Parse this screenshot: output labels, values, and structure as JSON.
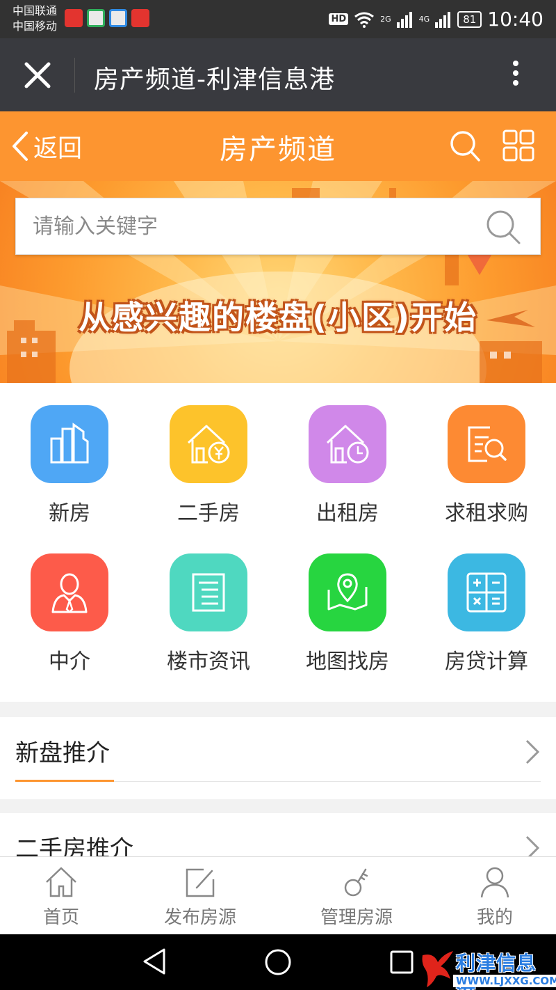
{
  "status_bar": {
    "carrier_1": "中国联通",
    "carrier_2": "中国移动",
    "hd": "HD",
    "net_2g": "2G",
    "net_4g": "4G",
    "battery": "81",
    "time": "10:40"
  },
  "titlebar": {
    "title": "房产频道-利津信息港"
  },
  "header": {
    "back_label": "返回",
    "title": "房产频道",
    "accent_color": "#fd9530"
  },
  "banner": {
    "search_placeholder": "请输入关键字",
    "slogan": "从感兴趣的楼盘(小区)开始"
  },
  "categories": [
    {
      "label": "新房",
      "icon": "buildings-icon",
      "color": "#4fa7f5"
    },
    {
      "label": "二手房",
      "icon": "house-yuan-icon",
      "color": "#fdc32b"
    },
    {
      "label": "出租房",
      "icon": "house-clock-icon",
      "color": "#d088e9"
    },
    {
      "label": "求租求购",
      "icon": "document-search-icon",
      "color": "#fd8a33"
    },
    {
      "label": "中介",
      "icon": "agent-person-icon",
      "color": "#fd5b4a"
    },
    {
      "label": "楼市资讯",
      "icon": "news-document-icon",
      "color": "#4fd8c0"
    },
    {
      "label": "地图找房",
      "icon": "map-pin-icon",
      "color": "#27d540"
    },
    {
      "label": "房贷计算",
      "icon": "calculator-icon",
      "color": "#3cb8e2"
    }
  ],
  "sections": {
    "new_homes": "新盘推介",
    "second_hand": "二手房推介"
  },
  "tabbar": [
    {
      "label": "首页",
      "icon": "home-icon"
    },
    {
      "label": "发布房源",
      "icon": "edit-icon"
    },
    {
      "label": "管理房源",
      "icon": "key-icon"
    },
    {
      "label": "我的",
      "icon": "user-icon"
    }
  ],
  "watermark": {
    "name": "利津信息港",
    "url": "WWW.LJXXG.COM"
  }
}
